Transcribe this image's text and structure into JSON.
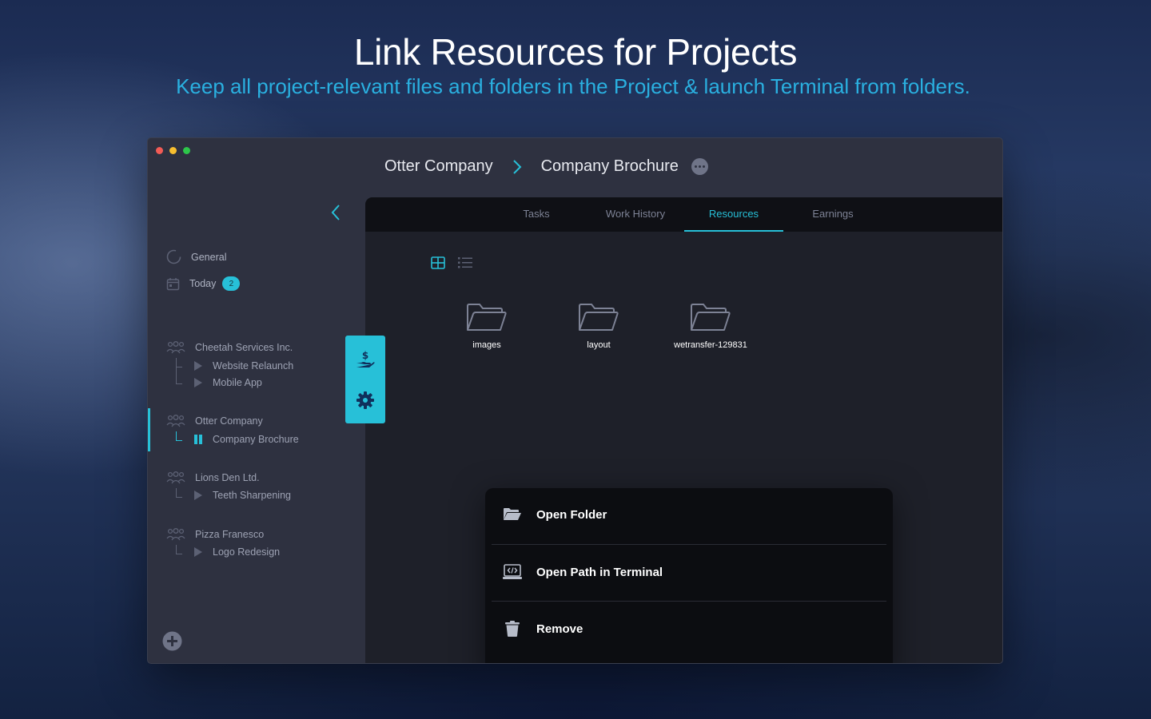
{
  "hero": {
    "title": "Link Resources for Projects",
    "subtitle": "Keep all project-relevant files and folders in the Project & launch Terminal from folders."
  },
  "breadcrumb": {
    "client": "Otter Company",
    "project": "Company Brochure"
  },
  "sidebar": {
    "general_label": "General",
    "today_label": "Today",
    "today_badge": "2",
    "clients": [
      {
        "name": "Cheetah Services Inc.",
        "projects": [
          "Website Relaunch",
          "Mobile App"
        ]
      },
      {
        "name": "Otter Company",
        "projects": [
          "Company Brochure"
        ]
      },
      {
        "name": "Lions Den Ltd.",
        "projects": [
          "Teeth Sharpening"
        ]
      },
      {
        "name": "Pizza Franesco",
        "projects": [
          "Logo Redesign"
        ]
      }
    ]
  },
  "tabs": [
    {
      "label": "Tasks"
    },
    {
      "label": "Work History"
    },
    {
      "label": "Resources",
      "active": true
    },
    {
      "label": "Earnings"
    }
  ],
  "resources": [
    {
      "name": "images",
      "icon": "folder-icon"
    },
    {
      "name": "layout",
      "icon": "folder-icon"
    },
    {
      "name": "wetransfer-129831",
      "icon": "folder-icon"
    }
  ],
  "context_menu": {
    "open_folder": "Open Folder",
    "open_terminal": "Open Path in Terminal",
    "remove": "Remove"
  },
  "colors": {
    "accent": "#27c0d8",
    "subtitle": "#2ab0e0",
    "window_bg": "#2e3140",
    "main_bg": "#1e2029",
    "tabbar_bg": "#0f1015"
  }
}
